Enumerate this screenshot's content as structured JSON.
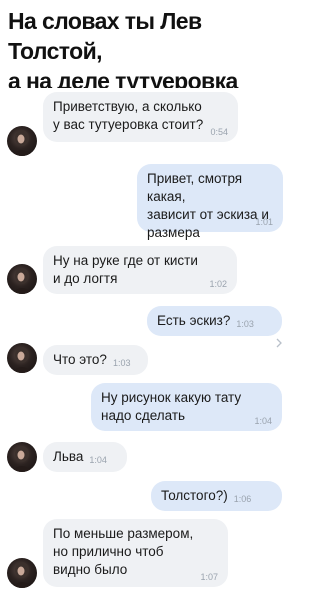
{
  "header": {
    "title_line1": "На словах ты Лев Толстой,",
    "title_line2": "а на деле тутуеровка"
  },
  "messages": [
    {
      "side": "in",
      "text": "Приветствую, а сколько\nу вас тутуеровка стоит?",
      "time": "0:54"
    },
    {
      "side": "out",
      "text": "Привет, смотря какая,\nзависит от эскиза и\nразмера",
      "time": "1:01"
    },
    {
      "side": "in",
      "text": "Ну на руке где от кисти\nи до логтя",
      "time": "1:02"
    },
    {
      "side": "out",
      "text": "Есть эскиз?",
      "time": "1:03"
    },
    {
      "side": "in",
      "text": "Что это?",
      "time": "1:03"
    },
    {
      "side": "out",
      "text": "Ну рисунок какую тату\nнадо сделать",
      "time": "1:04"
    },
    {
      "side": "in",
      "text": "Льва",
      "time": "1:04"
    },
    {
      "side": "out",
      "text": "Толстого?)",
      "time": "1:06"
    },
    {
      "side": "in",
      "text": "По меньше размером,\nно прилично чтоб\nвидно было",
      "time": "1:07"
    }
  ],
  "colors": {
    "incoming_bubble": "#eff1f4",
    "outgoing_bubble": "#dde8f8",
    "time_text": "#9aa3ae"
  },
  "icons": {
    "avatar": "contact-avatar",
    "chevron": "chevron-right-icon"
  }
}
